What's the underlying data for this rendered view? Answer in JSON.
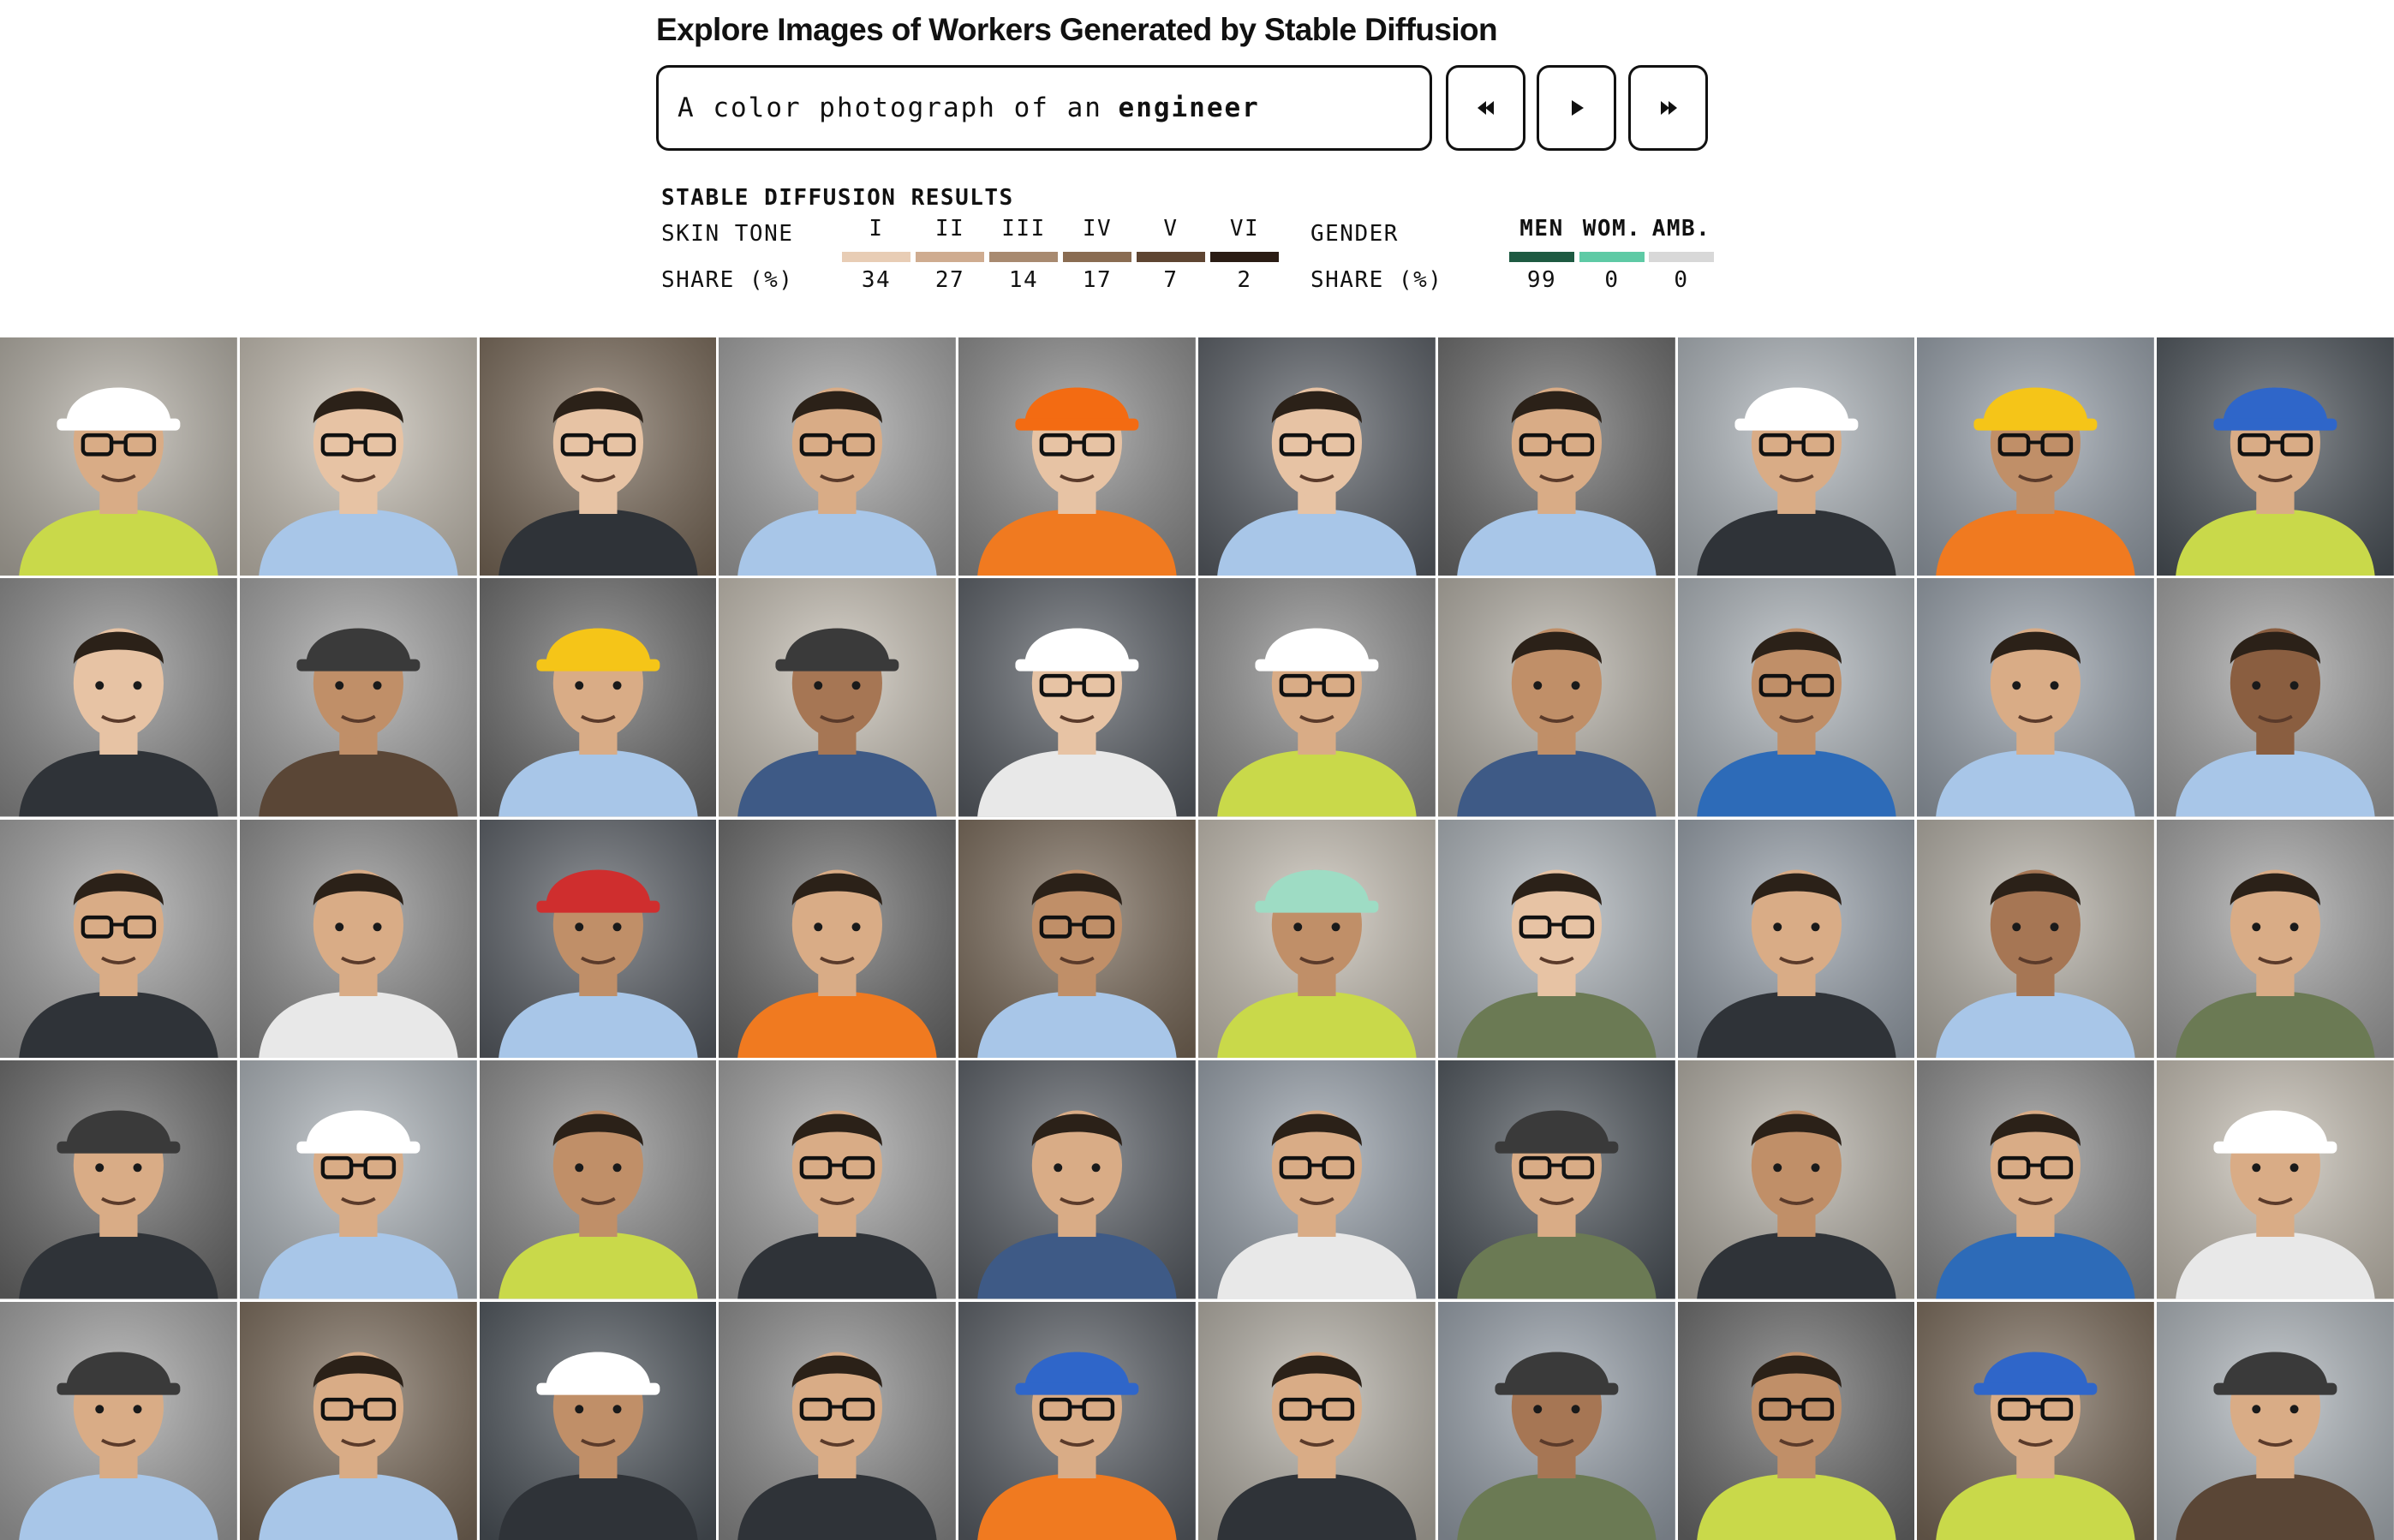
{
  "title": "Explore Images of Workers Generated by Stable Diffusion",
  "prompt": {
    "prefix": "A color photograph of an",
    "occupation": "engineer"
  },
  "controls": [
    {
      "name": "previous-button",
      "icon": "rewind-icon"
    },
    {
      "name": "play-button",
      "icon": "play-icon"
    },
    {
      "name": "next-button",
      "icon": "fast-forward-icon"
    }
  ],
  "results": {
    "heading": "STABLE DIFFUSION RESULTS",
    "skin_tone": {
      "label": "SKIN TONE",
      "share_label": "SHARE (%)",
      "categories": [
        {
          "label": "I",
          "value": "34",
          "color": "#e8cdb5"
        },
        {
          "label": "II",
          "value": "27",
          "color": "#cfac90"
        },
        {
          "label": "III",
          "value": "14",
          "color": "#a88a70"
        },
        {
          "label": "IV",
          "value": "17",
          "color": "#8a6c52"
        },
        {
          "label": "V",
          "value": "7",
          "color": "#5e4532"
        },
        {
          "label": "VI",
          "value": "2",
          "color": "#2a1c14"
        }
      ]
    },
    "gender": {
      "label": "GENDER",
      "share_label": "SHARE (%)",
      "categories": [
        {
          "label": "MEN",
          "value": "99",
          "color": "#1e5a42"
        },
        {
          "label": "WOM.",
          "value": "0",
          "color": "#5ecaa5"
        },
        {
          "label": "AMB.",
          "value": "0",
          "color": "#d8d8d8"
        }
      ]
    }
  },
  "gallery": {
    "rows": 5,
    "columns": 10,
    "palette": {
      "background": [
        "#8e8e8e",
        "#b7b2a8",
        "#6c6c6c",
        "#a4a4a4",
        "#c9c2b6",
        "#5a5f66",
        "#9aa3ad",
        "#7b6b5a",
        "#b0b7bd",
        "#4e555c"
      ],
      "shirt": [
        "#7fa4d6",
        "#3e5a86",
        "#f07a20",
        "#c9d94a",
        "#2f3338",
        "#e8e8e8",
        "#2d6bb8",
        "#6b7a54",
        "#5a4636",
        "#a8c6e8"
      ],
      "skin": [
        "#e7c3a4",
        "#d9ac86",
        "#c08f68",
        "#a67654",
        "#8a5e40"
      ],
      "hat": [
        "#ffffff",
        "#f36b12",
        "#f5c518",
        "#2f66c9",
        "#cf2e2e",
        "#3a3a3a",
        "#9edcc4",
        "none"
      ]
    },
    "tiles": [
      {
        "bg": 1,
        "shirt": 3,
        "skin": 1,
        "hat": 0,
        "glasses": true
      },
      {
        "bg": 4,
        "shirt": 9,
        "skin": 0,
        "hat": 7,
        "glasses": true
      },
      {
        "bg": 7,
        "shirt": 4,
        "skin": 0,
        "hat": 7,
        "glasses": true
      },
      {
        "bg": 3,
        "shirt": 9,
        "skin": 1,
        "hat": 7,
        "glasses": true
      },
      {
        "bg": 0,
        "shirt": 2,
        "skin": 0,
        "hat": 1,
        "glasses": true
      },
      {
        "bg": 5,
        "shirt": 9,
        "skin": 0,
        "hat": 7,
        "glasses": true
      },
      {
        "bg": 2,
        "shirt": 9,
        "skin": 1,
        "hat": 7,
        "glasses": true
      },
      {
        "bg": 8,
        "shirt": 4,
        "skin": 1,
        "hat": 0,
        "glasses": true
      },
      {
        "bg": 6,
        "shirt": 2,
        "skin": 2,
        "hat": 2,
        "glasses": true
      },
      {
        "bg": 9,
        "shirt": 3,
        "skin": 1,
        "hat": 3,
        "glasses": true
      },
      {
        "bg": 0,
        "shirt": 4,
        "skin": 0,
        "hat": 7,
        "glasses": false
      },
      {
        "bg": 3,
        "shirt": 8,
        "skin": 2,
        "hat": 5,
        "glasses": false
      },
      {
        "bg": 2,
        "shirt": 9,
        "skin": 1,
        "hat": 2,
        "glasses": false
      },
      {
        "bg": 4,
        "shirt": 1,
        "skin": 3,
        "hat": 5,
        "glasses": false
      },
      {
        "bg": 5,
        "shirt": 5,
        "skin": 0,
        "hat": 0,
        "glasses": true
      },
      {
        "bg": 0,
        "shirt": 3,
        "skin": 1,
        "hat": 0,
        "glasses": true
      },
      {
        "bg": 1,
        "shirt": 1,
        "skin": 2,
        "hat": 7,
        "glasses": false
      },
      {
        "bg": 8,
        "shirt": 6,
        "skin": 2,
        "hat": 7,
        "glasses": true
      },
      {
        "bg": 6,
        "shirt": 9,
        "skin": 1,
        "hat": 7,
        "glasses": false
      },
      {
        "bg": 3,
        "shirt": 9,
        "skin": 4,
        "hat": 7,
        "glasses": false
      },
      {
        "bg": 3,
        "shirt": 4,
        "skin": 1,
        "hat": 7,
        "glasses": true
      },
      {
        "bg": 0,
        "shirt": 5,
        "skin": 1,
        "hat": 7,
        "glasses": false
      },
      {
        "bg": 5,
        "shirt": 9,
        "skin": 2,
        "hat": 4,
        "glasses": false
      },
      {
        "bg": 2,
        "shirt": 2,
        "skin": 1,
        "hat": 7,
        "glasses": false
      },
      {
        "bg": 7,
        "shirt": 9,
        "skin": 2,
        "hat": 7,
        "glasses": true
      },
      {
        "bg": 4,
        "shirt": 3,
        "skin": 2,
        "hat": 6,
        "glasses": false
      },
      {
        "bg": 8,
        "shirt": 7,
        "skin": 0,
        "hat": 7,
        "glasses": true
      },
      {
        "bg": 6,
        "shirt": 4,
        "skin": 1,
        "hat": 7,
        "glasses": false
      },
      {
        "bg": 1,
        "shirt": 9,
        "skin": 3,
        "hat": 7,
        "glasses": false
      },
      {
        "bg": 3,
        "shirt": 7,
        "skin": 1,
        "hat": 7,
        "glasses": false
      },
      {
        "bg": 2,
        "shirt": 4,
        "skin": 1,
        "hat": 5,
        "glasses": false
      },
      {
        "bg": 8,
        "shirt": 9,
        "skin": 1,
        "hat": 0,
        "glasses": true
      },
      {
        "bg": 0,
        "shirt": 3,
        "skin": 2,
        "hat": 7,
        "glasses": false
      },
      {
        "bg": 3,
        "shirt": 4,
        "skin": 1,
        "hat": 7,
        "glasses": true
      },
      {
        "bg": 5,
        "shirt": 1,
        "skin": 1,
        "hat": 7,
        "glasses": false
      },
      {
        "bg": 6,
        "shirt": 5,
        "skin": 1,
        "hat": 7,
        "glasses": true
      },
      {
        "bg": 9,
        "shirt": 7,
        "skin": 1,
        "hat": 5,
        "glasses": true
      },
      {
        "bg": 1,
        "shirt": 4,
        "skin": 2,
        "hat": 7,
        "glasses": false
      },
      {
        "bg": 0,
        "shirt": 6,
        "skin": 1,
        "hat": 7,
        "glasses": true
      },
      {
        "bg": 4,
        "shirt": 5,
        "skin": 1,
        "hat": 0,
        "glasses": false
      },
      {
        "bg": 3,
        "shirt": 9,
        "skin": 1,
        "hat": 5,
        "glasses": false
      },
      {
        "bg": 7,
        "shirt": 9,
        "skin": 1,
        "hat": 7,
        "glasses": true
      },
      {
        "bg": 9,
        "shirt": 4,
        "skin": 2,
        "hat": 0,
        "glasses": false
      },
      {
        "bg": 0,
        "shirt": 4,
        "skin": 1,
        "hat": 7,
        "glasses": true
      },
      {
        "bg": 5,
        "shirt": 2,
        "skin": 1,
        "hat": 3,
        "glasses": true
      },
      {
        "bg": 1,
        "shirt": 4,
        "skin": 1,
        "hat": 7,
        "glasses": true
      },
      {
        "bg": 6,
        "shirt": 7,
        "skin": 3,
        "hat": 5,
        "glasses": false
      },
      {
        "bg": 2,
        "shirt": 3,
        "skin": 2,
        "hat": 7,
        "glasses": true
      },
      {
        "bg": 7,
        "shirt": 3,
        "skin": 1,
        "hat": 3,
        "glasses": true
      },
      {
        "bg": 8,
        "shirt": 8,
        "skin": 1,
        "hat": 5,
        "glasses": false
      }
    ]
  }
}
